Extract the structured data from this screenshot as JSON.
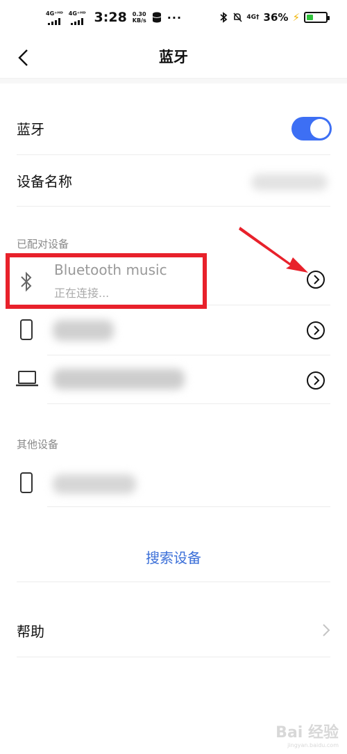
{
  "status_bar": {
    "net1": "4G⁺ᴴᴰ",
    "net2": "4G⁺ᴴᴰ",
    "time": "3:28",
    "speed_value": "0.30",
    "speed_unit": "KB/s",
    "more": "···",
    "net3": "4G†",
    "battery_percent": "36%",
    "battery_level": 0.36,
    "battery_color": "#2fc23b"
  },
  "nav": {
    "title": "蓝牙",
    "back_icon": "chevron-left-icon"
  },
  "bluetooth_row": {
    "label": "蓝牙",
    "toggle_on": true,
    "accent": "#3d6ff4"
  },
  "device_name_row": {
    "label": "设备名称"
  },
  "paired": {
    "header": "已配对设备",
    "devices": [
      {
        "icon": "bluetooth-icon",
        "name": "Bluetooth music",
        "status": "正在连接..."
      },
      {
        "icon": "phone-icon"
      },
      {
        "icon": "laptop-icon"
      }
    ]
  },
  "other": {
    "header": "其他设备",
    "devices": [
      {
        "icon": "phone-icon"
      }
    ]
  },
  "search_label": "搜索设备",
  "help_label": "帮助",
  "annotation_color": "#e8212b",
  "watermark": {
    "text": "Bai 经验",
    "sub": "jingyan.baidu.com"
  }
}
